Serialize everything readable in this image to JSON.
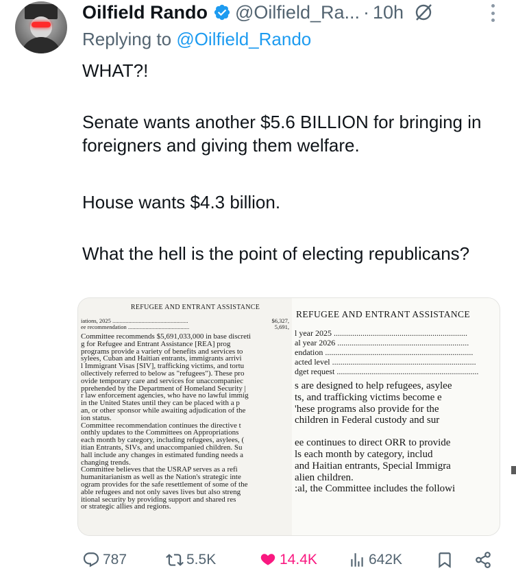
{
  "header": {
    "display_name": "Oilfield Rando",
    "handle": "@Oilfield_Ra...",
    "separator": "·",
    "time": "10h"
  },
  "reply": {
    "prefix": "Replying to",
    "mention": "@Oilfield_Rando"
  },
  "tweet": {
    "paragraphs": [
      "WHAT?!",
      "Senate wants another $5.6 BILLION for bringing in foreigners and giving them welfare.",
      "House wants $4.3 billion.",
      "What the hell is the point of electing republicans?"
    ]
  },
  "media": {
    "left": {
      "title": "REFUGEE AND ENTRANT ASSISTANCE",
      "table": [
        {
          "label": "iations, 2025 ....................................................",
          "value": "$6,327,"
        },
        {
          "label": "ee recommendation ..........................................",
          "value": "5,691,"
        }
      ],
      "lines": [
        "Committee recommends $5,691,033,000 in base discreti",
        "g for Refugee and Entrant Assistance [REA] prog",
        "programs provide a variety of benefits and services to",
        "sylees, Cuban and Haitian entrants, immigrants arrivi",
        "l Immigrant Visas [SIV], trafficking victims, and tortu",
        "ollectively referred to below as \"refugees\"). These pro",
        "ovide temporary care and services for unaccompaniec",
        "pprehended by the Department of Homeland Security |",
        "r law enforcement agencies, who have no lawful immig",
        "in the United States until they can be placed with a p",
        "an, or other sponsor while awaiting adjudication of the",
        "ion status.",
        "Committee recommendation continues the directive t",
        "onthly updates to the Committees on Appropriations",
        "each month by category, including refugees, asylees, (",
        "itian Entrants, SIVs, and unaccompanied children. Su",
        "hall include any changes in estimated funding needs a",
        "changing trends.",
        "Committee believes that the USRAP serves as a refi",
        " humanitarianism as well as the Nation's strategic inte",
        "ogram provides for the safe resettlement of some of the",
        "able refugees and not only saves lives but also streng",
        "itional security by providing support and shared res",
        "or strategic allies and regions."
      ]
    },
    "right": {
      "title": "REFUGEE AND ENTRANT ASSISTANCE",
      "table": [
        "l year 2025 .................................................................",
        "al year 2026 ................................................................",
        "endation ........................................................................",
        "acted level ......................................................................",
        "dget request ....................................................................."
      ],
      "lines_a": [
        "s are designed to help refugees, asylee",
        "ts, and trafficking victims become e",
        "'hese programs also provide for the",
        "children in Federal custody and sur"
      ],
      "lines_b": [
        "ee continues to direct ORR to provide",
        "ls each month by category, includ",
        "and Haitian entrants, Special Immigra",
        "alien children.",
        ":al, the Committee includes the followi"
      ]
    }
  },
  "actions": {
    "replies": "787",
    "retweets": "5.5K",
    "likes": "14.4K",
    "views": "642K"
  },
  "icons": {
    "verified": "verified-badge-icon",
    "grok": "grok-icon",
    "more": "more-options-icon",
    "reply": "reply-icon",
    "retweet": "retweet-icon",
    "like": "heart-icon",
    "views": "views-icon",
    "bookmark": "bookmark-icon",
    "share": "share-icon"
  },
  "colors": {
    "text": "#0f1419",
    "secondary": "#536471",
    "link": "#1d9bf0",
    "like": "#f91880"
  }
}
